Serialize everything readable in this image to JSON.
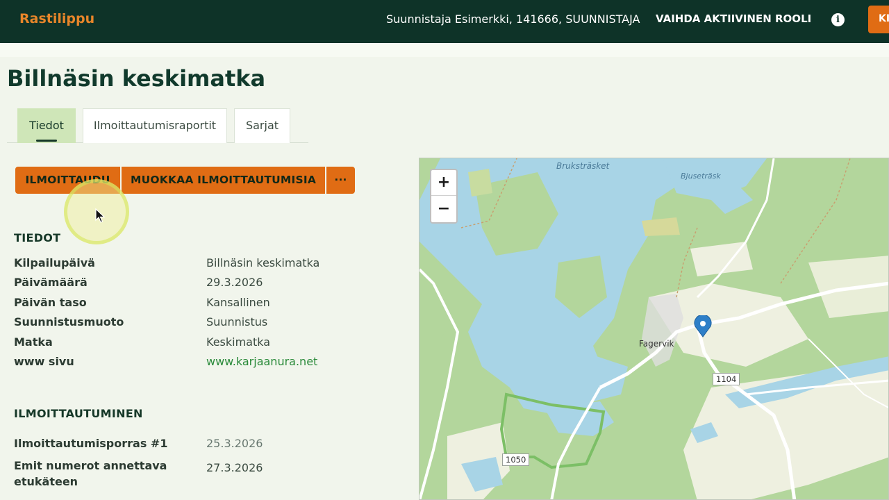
{
  "header": {
    "brand": "Rastilippu",
    "user_info": "Suunnistaja Esimerkki, 141666, SUUNNISTAJA",
    "role_button": "VAIHDA AKTIIVINEN ROOLI",
    "info_icon": "info-icon",
    "partial_button": "KI"
  },
  "page": {
    "title": "Billnäsin keskimatka"
  },
  "tabs": [
    {
      "label": "Tiedot",
      "active": true
    },
    {
      "label": "Ilmoittautumisraportit",
      "active": false
    },
    {
      "label": "Sarjat",
      "active": false
    }
  ],
  "actions": {
    "register": "ILMOITTAUDU",
    "edit_registrations": "MUOKKAA ILMOITTAUTUMISIA",
    "more": "···"
  },
  "details": {
    "title": "TIEDOT",
    "rows": [
      {
        "label": "Kilpailupäivä",
        "value": "Billnäsin keskimatka"
      },
      {
        "label": "Päivämäärä",
        "value": "29.3.2026"
      },
      {
        "label": "Päivän taso",
        "value": "Kansallinen"
      },
      {
        "label": "Suunnistusmuoto",
        "value": "Suunnistus"
      },
      {
        "label": "Matka",
        "value": "Keskimatka"
      },
      {
        "label": "www sivu",
        "value": "www.karjaanura.net"
      }
    ]
  },
  "registration": {
    "title": "ILMOITTAUTUMINEN",
    "rows": [
      {
        "label": "Ilmoittautumisporras #1",
        "value": "25.3.2026"
      },
      {
        "label": "Emit numerot annettava etukäteen",
        "value": "27.3.2026"
      }
    ]
  },
  "map": {
    "zoom_in": "+",
    "zoom_out": "−",
    "labels": {
      "bruks": "Bruksträsket",
      "bjuse": "Bjuseträsk",
      "fagervik": "Fagervik"
    },
    "roads": {
      "r1104": "1104",
      "r1050": "1050"
    },
    "marker_icon": "map-marker-icon"
  },
  "colors": {
    "header_bg": "#0e3328",
    "brand": "#e8862a",
    "accent_button": "#e06c14",
    "active_tab": "#cfe6b8",
    "link": "#2a8a3a"
  }
}
